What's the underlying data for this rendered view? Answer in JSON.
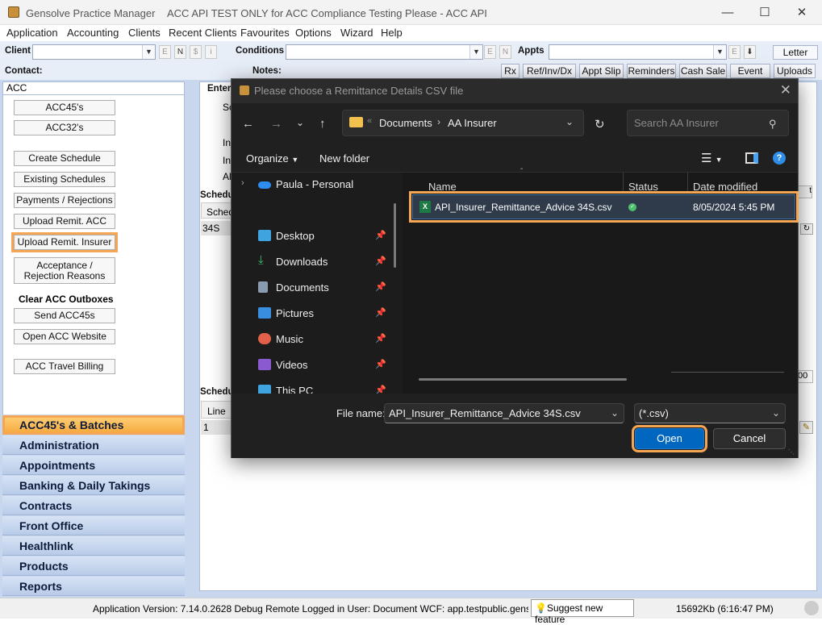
{
  "window": {
    "app_name": "Gensolve Practice Manager",
    "title": "ACC API TEST ONLY for ACC Compliance Testing Please - ACC API"
  },
  "menu": [
    "Application",
    "Accounting",
    "Clients",
    "Recent Clients",
    "Favourites",
    "Options",
    "Wizard",
    "Help"
  ],
  "toolbar": {
    "client_label": "Client",
    "conditions_label": "Conditions",
    "appts_label": "Appts",
    "letter_button": "Letter",
    "contact_label": "Contact:",
    "notes_label": "Notes:",
    "mini_buttons": [
      "E",
      "N",
      "$",
      "i"
    ],
    "cond_mini": [
      "E",
      "N"
    ],
    "appt_mini": [
      "E"
    ],
    "action_buttons": [
      "Rx",
      "Ref/Inv/Dx",
      "Appt Slip",
      "Reminders",
      "Cash Sale",
      "Event",
      "Uploads"
    ]
  },
  "sidebar": {
    "header": "ACC",
    "buttons": [
      "ACC45's",
      "ACC32's",
      "Create Schedule",
      "Existing Schedules",
      "Payments / Rejections",
      "Upload Remit. ACC",
      "Upload Remit. Insurer"
    ],
    "acceptance_button_line1": "Acceptance /",
    "acceptance_button_line2": "Rejection Reasons",
    "outbox_heading": "Clear ACC Outboxes",
    "buttons2": [
      "Send ACC45s",
      "Open ACC Website",
      "ACC Travel Billing"
    ],
    "nav": [
      "ACC45's & Batches",
      "Administration",
      "Appointments",
      "Banking & Daily Takings",
      "Contracts",
      "Front Office",
      "Healthlink",
      "Products",
      "Reports"
    ]
  },
  "main": {
    "enter_label": "Enter",
    "sc_label": "Sc",
    "int1": "Int",
    "int2": "Int",
    "al_label": "Al",
    "sched1_label": "Schedu",
    "sched_col": "Sched",
    "sched_value": "34S",
    "sched2_label": "Schedu",
    "line_col": "Line",
    "line_value": "1",
    "partial_value": "00",
    "partial_t": "t"
  },
  "status": {
    "version": "Application Version: 7.14.0.2628 Debug Remote  Logged in User: Document WCF: app.testpublic.gensolve.com:45",
    "suggest": "Suggest new feature",
    "memory": "15692Kb  (6:16:47 PM)"
  },
  "dialog": {
    "title": "Please choose a Remittance Details CSV file",
    "breadcrumb": [
      "Documents",
      "AA Insurer"
    ],
    "search_placeholder": "Search AA Insurer",
    "organize": "Organize",
    "new_folder": "New folder",
    "nav_items": [
      {
        "name": "Paula - Personal",
        "icon": "cloud-icon"
      },
      {
        "name": "Desktop",
        "icon": "desktop-icon"
      },
      {
        "name": "Downloads",
        "icon": "download-icon"
      },
      {
        "name": "Documents",
        "icon": "documents-icon"
      },
      {
        "name": "Pictures",
        "icon": "pictures-icon"
      },
      {
        "name": "Music",
        "icon": "music-icon"
      },
      {
        "name": "Videos",
        "icon": "videos-icon"
      },
      {
        "name": "This PC",
        "icon": "pc-icon"
      }
    ],
    "columns": [
      "Name",
      "Status",
      "Date modified"
    ],
    "file": {
      "name": "API_Insurer_Remittance_Advice 34S.csv",
      "date": "8/05/2024 5:45 PM"
    },
    "filename_label": "File name:",
    "filename_value": "API_Insurer_Remittance_Advice 34S.csv",
    "filter": "(*.csv)",
    "open": "Open",
    "cancel": "Cancel"
  },
  "colors": {
    "highlight": "#f5a654",
    "nav_active": "#f5a83c",
    "dialog_bg": "#202020",
    "accent_blue": "#0067c0"
  }
}
